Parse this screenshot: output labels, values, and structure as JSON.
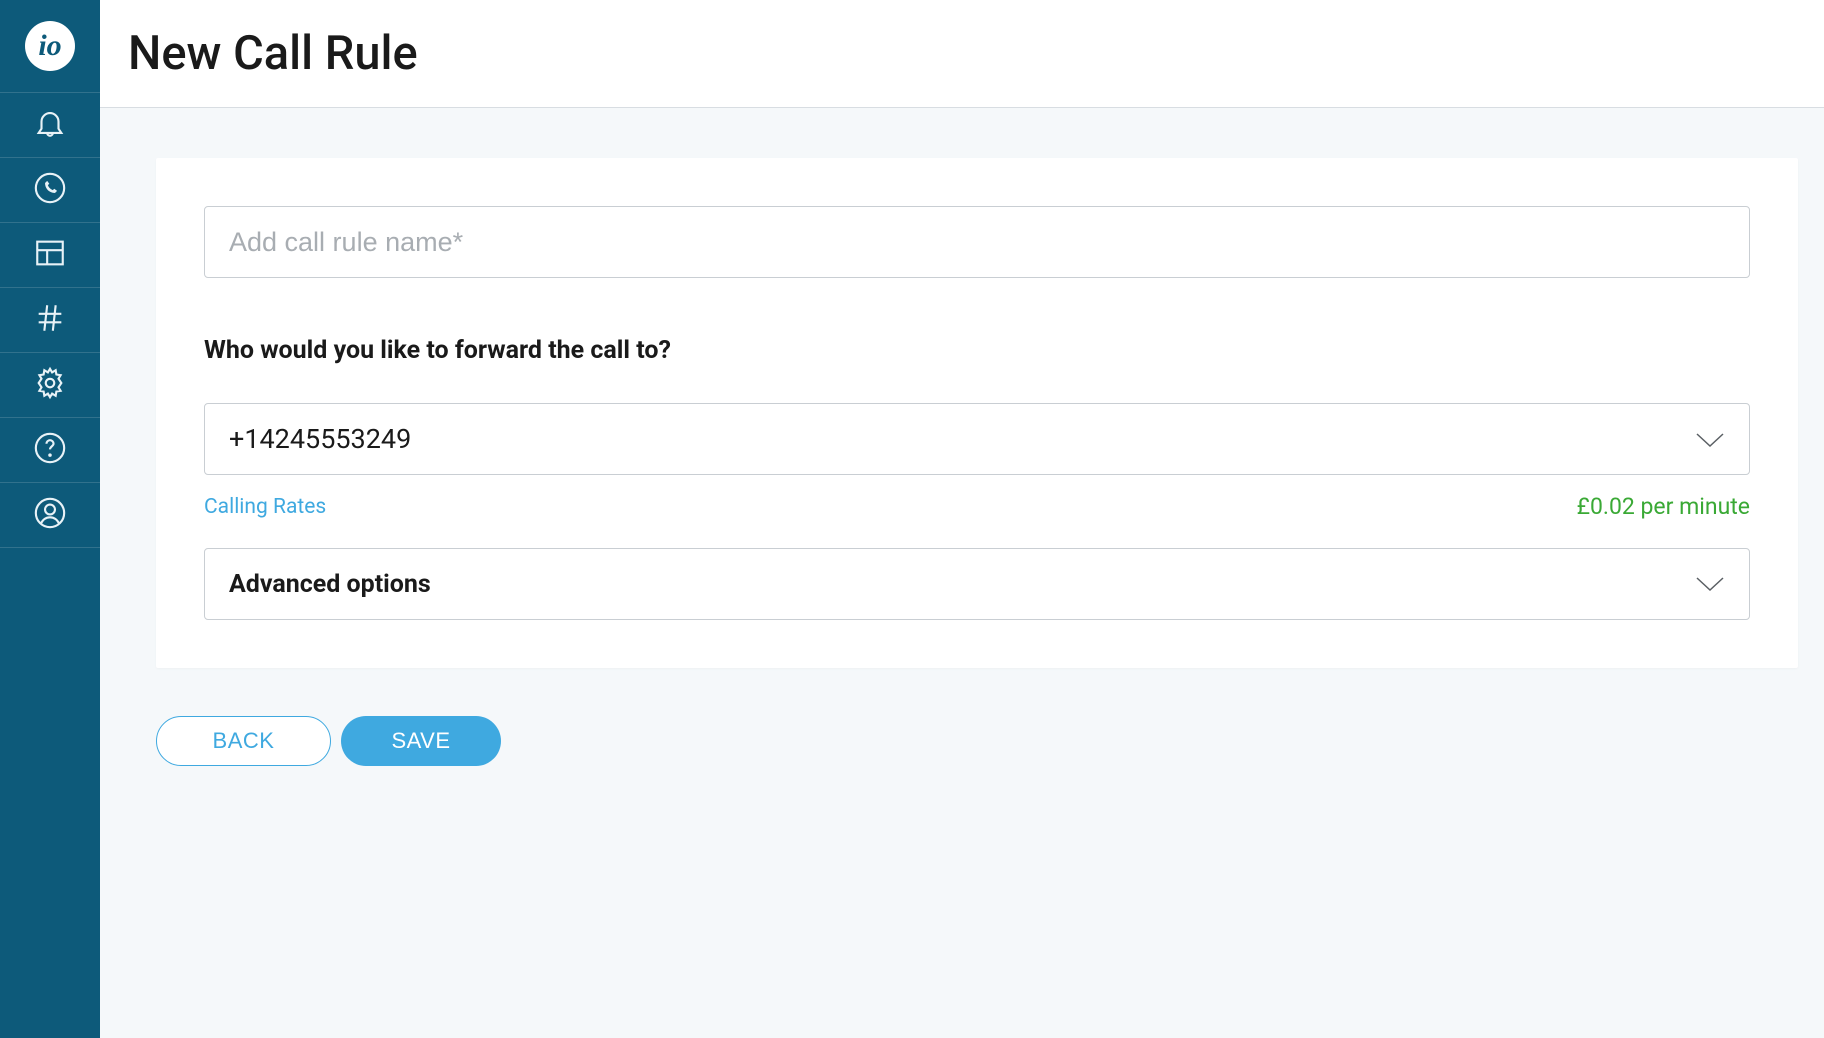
{
  "brand": {
    "logo_text": "io"
  },
  "header": {
    "title": "New Call Rule"
  },
  "form": {
    "name_placeholder": "Add call rule name*",
    "forward_heading": "Who would you like to forward the call to?",
    "forward_value": "+14245553249",
    "calling_rates_link": "Calling Rates",
    "rate_price": "£0.02 per minute",
    "advanced_label": "Advanced options"
  },
  "buttons": {
    "back": "BACK",
    "save": "SAVE"
  },
  "sidebar": {
    "items": [
      {
        "name": "notifications"
      },
      {
        "name": "calls"
      },
      {
        "name": "dashboard"
      },
      {
        "name": "numbers"
      },
      {
        "name": "settings"
      },
      {
        "name": "help"
      },
      {
        "name": "account"
      }
    ]
  }
}
